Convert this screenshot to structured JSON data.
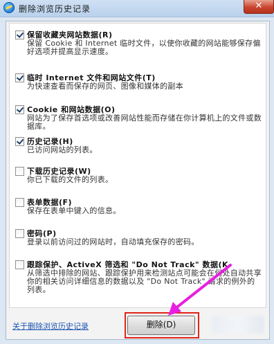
{
  "window": {
    "title": "删除浏览历史记录",
    "close_symbol": "✕"
  },
  "options": [
    {
      "checked": true,
      "title": "保留收藏夹网站数据(R)",
      "description": "保留 Cookie 和 Internet 临时文件，以使你收藏的网站能够保存偏好选项并提高显示速度。"
    },
    {
      "checked": true,
      "title": "临时 Internet 文件和网站文件(T)",
      "description": "为快速查看而保存的网页、图像和媒体的副本"
    },
    {
      "checked": true,
      "title": "Cookie 和网站数据(O)",
      "description": "网站为了保存首选项或改善网站性能而存储在你计算机上的文件或数据库。"
    },
    {
      "checked": true,
      "title": "历史记录(H)",
      "description": "已访问网站的列表。"
    },
    {
      "checked": false,
      "title": "下载历史记录(W)",
      "description": "你已下载的文件的列表。"
    },
    {
      "checked": false,
      "title": "表单数据(F)",
      "description": "保存在表单中键入的信息。"
    },
    {
      "checked": false,
      "title": "密码(P)",
      "description": "登录以前访问过的网站时，自动填充保存的密码。"
    },
    {
      "checked": false,
      "title": "跟踪保护、ActiveX 筛选和 \"Do Not Track\" 数据(K",
      "description": "从筛选中排除的网站、跟踪保护用来检测站点可能会在何处自动共享你的相关访问详细信息的数据以及 \"Do Not Track\" 请求的例外的列表。"
    }
  ],
  "footer": {
    "about_link": "关于删除浏览历史记录",
    "delete_label": "删除(D)"
  },
  "colors": {
    "highlight_box": "#e02418",
    "pointer_arrow": "#e81fe0"
  }
}
